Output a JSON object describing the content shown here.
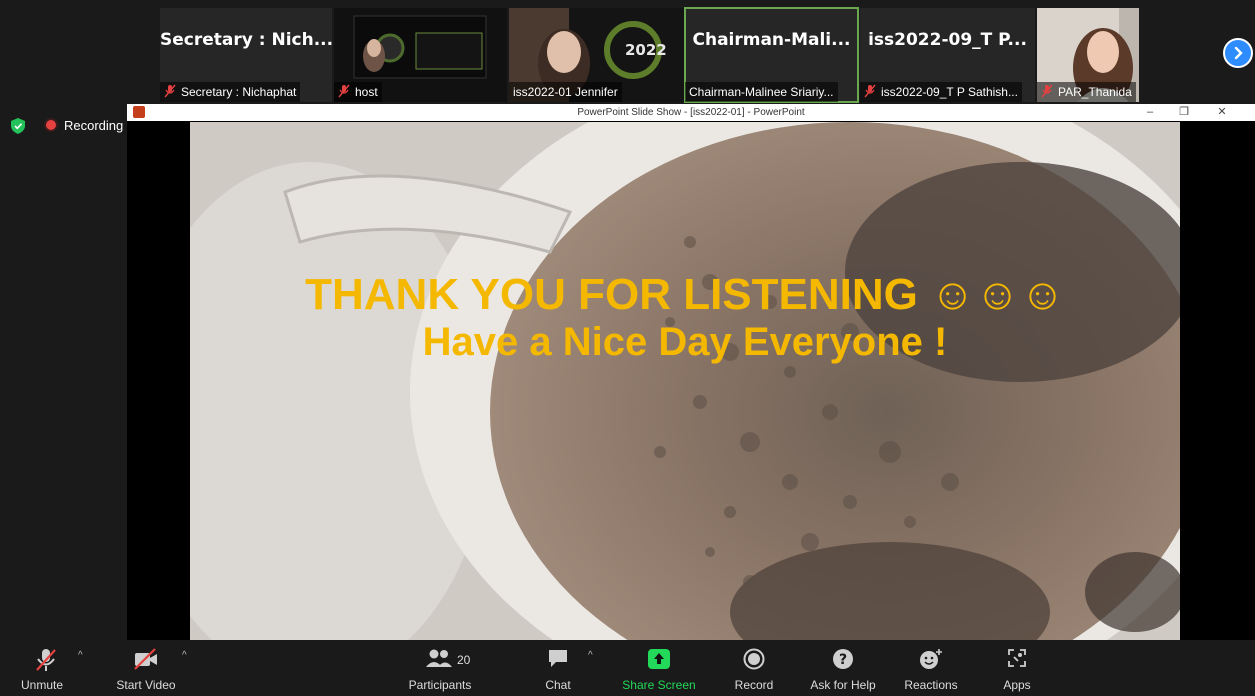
{
  "participants": [
    {
      "big_name": "Secretary : Nich...",
      "caption": "Secretary : Nichaphat",
      "muted": true
    },
    {
      "big_name": "",
      "caption": "host",
      "muted": true
    },
    {
      "big_name": "",
      "caption": "iss2022-01 Jennifer",
      "muted": false
    },
    {
      "big_name": "Chairman-Mali...",
      "caption": "Chairman-Malinee Sriariy...",
      "muted": false,
      "active_speaker": true
    },
    {
      "big_name": "iss2022-09_T P...",
      "caption": "iss2022-09_T P Sathish...",
      "muted": true
    },
    {
      "big_name": "",
      "caption": "PAR_Thanida",
      "muted": true
    }
  ],
  "recording": {
    "label": "Recording"
  },
  "window": {
    "title": "PowerPoint Slide Show - [iss2022-01] - PowerPoint"
  },
  "slide": {
    "line1": "THANK YOU FOR LISTENING ☺☺☺",
    "line2": "Have a Nice Day Everyone !",
    "text_color": "#f5b800"
  },
  "toolbar": {
    "unmute": "Unmute",
    "start_video": "Start Video",
    "participants": "Participants",
    "participants_count": "20",
    "chat": "Chat",
    "share_screen": "Share Screen",
    "record": "Record",
    "ask_for_help": "Ask for Help",
    "reactions": "Reactions",
    "apps": "Apps"
  },
  "colors": {
    "share_green": "#23d959",
    "accent_blue": "#2d8cff",
    "rec_red": "#e64141"
  }
}
